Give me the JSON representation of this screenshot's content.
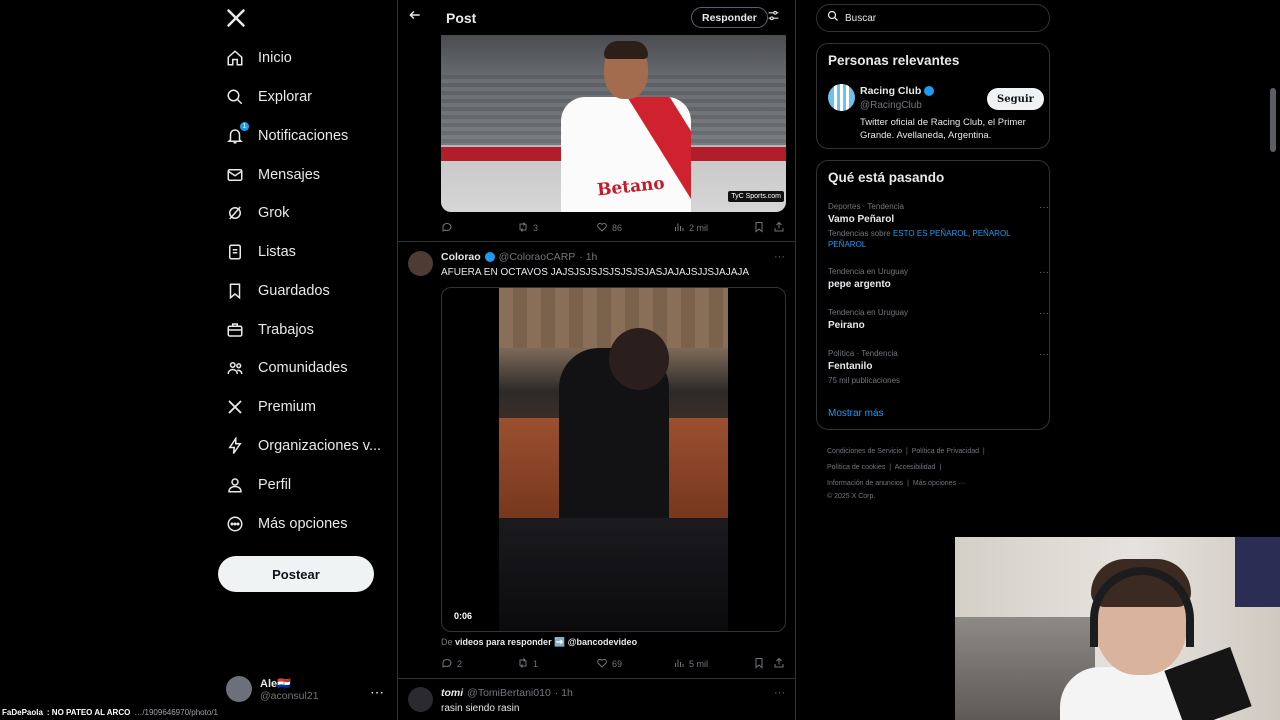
{
  "logo": "X",
  "nav": {
    "items": [
      {
        "label": "Inicio",
        "icon": "home-icon"
      },
      {
        "label": "Explorar",
        "icon": "search-icon"
      },
      {
        "label": "Notificaciones",
        "icon": "bell-icon",
        "badge": "1"
      },
      {
        "label": "Mensajes",
        "icon": "mail-icon"
      },
      {
        "label": "Grok",
        "icon": "grok-icon"
      },
      {
        "label": "Listas",
        "icon": "list-icon"
      },
      {
        "label": "Guardados",
        "icon": "bookmark-icon"
      },
      {
        "label": "Trabajos",
        "icon": "briefcase-icon"
      },
      {
        "label": "Comunidades",
        "icon": "people-icon"
      },
      {
        "label": "Premium",
        "icon": "x-icon"
      },
      {
        "label": "Organizaciones v...",
        "icon": "lightning-icon"
      },
      {
        "label": "Perfil",
        "icon": "person-icon"
      },
      {
        "label": "Más opciones",
        "icon": "more-circle-icon"
      }
    ],
    "post_button": "Postear"
  },
  "account": {
    "name": "Ale🇵🇾",
    "handle": "@aconsul21",
    "more": "⋯"
  },
  "header": {
    "title": "Post",
    "reply_button": "Responder"
  },
  "tweet1": {
    "image_badge": "TyC Sports.com",
    "image_sponsor": "Betano",
    "replies": "",
    "reposts": "3",
    "likes": "86",
    "views": "2 mil"
  },
  "tweet2": {
    "name": "Colorao",
    "handle": "@ColoraoCARP",
    "time": "· 1h",
    "text": "AFUERA EN OCTAVOS JAJSJSJSJSJSJSJSJASJAJAJSJJSJAJAJA",
    "video_time": "0:06",
    "from_prefix": "De",
    "from_account": "videos para responder ➡️ @bancodevideo",
    "replies": "2",
    "reposts": "1",
    "likes": "69",
    "views": "5 mil"
  },
  "tweet3": {
    "name": "tomi",
    "handle": "@TomiBertani010",
    "time": "· 1h",
    "text": "rasin siendo rasin"
  },
  "search": {
    "placeholder": "Buscar"
  },
  "relevant": {
    "title": "Personas relevantes",
    "name": "Racing Club",
    "handle": "@RacingClub",
    "follow": "Seguir",
    "bio": "Twitter oficial de Racing Club, el Primer Grande. Avellaneda, Argentina."
  },
  "trends": {
    "title": "Qué está pasando",
    "items": [
      {
        "meta": "Deportes · Tendencia",
        "name": "Vamo Peñarol",
        "extra_prefix": "Tendencias sobre",
        "extra_links": "ESTO ES PEÑAROL, PEÑAROL PEÑAROL"
      },
      {
        "meta": "Tendencia en Uruguay",
        "name": "pepe argento"
      },
      {
        "meta": "Tendencia en Uruguay",
        "name": "Peirano"
      },
      {
        "meta": "Política · Tendencia",
        "name": "Fentanilo",
        "extra": "75 mil publicaciones"
      }
    ],
    "show_more": "Mostrar más"
  },
  "footer": {
    "terms": "Condiciones de Servicio",
    "privacy": "Política de Privacidad",
    "cookies": "Política de cookies",
    "accessibility": "Accesibilidad",
    "ads": "Información de anuncios",
    "more": "Más opciones ···",
    "copyright": "© 2025 X Corp."
  },
  "overlay": {
    "status_name": "FaDePaola",
    "status_text": ": NO PATEO AL ARCO",
    "status_url": "…/1909646970/photo/1"
  },
  "colors": {
    "accent": "#1d9bf0",
    "background": "#000000",
    "border": "#2f3336",
    "muted": "#71767b"
  }
}
